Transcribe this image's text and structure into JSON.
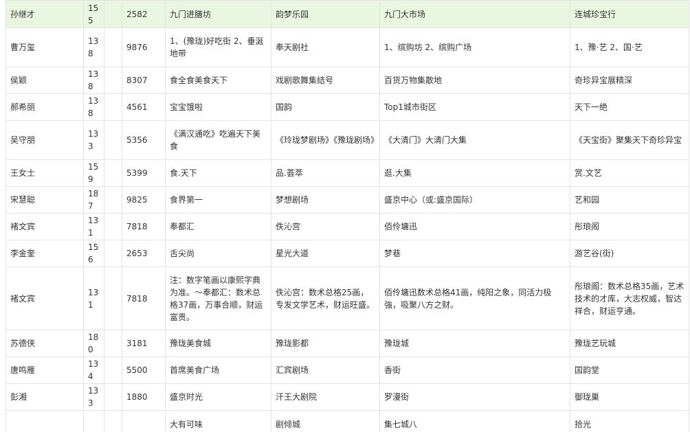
{
  "rows": [
    {
      "name": "孙继才",
      "prefix": "155",
      "suffix": "2582",
      "c1": "九门进膳坊",
      "c2": "韵梦乐园",
      "c3": "九门大市场",
      "c4": "连城珍宝行"
    },
    {
      "name": "曹万玺",
      "prefix": "138",
      "suffix": "9876",
      "c1": "1、(豫珑)好吃街 2、垂涎地带",
      "c2": "奉天剧社",
      "c3": "1、缤购坊 2、缤购广场",
      "c4": "1、豫·艺 2、国·艺"
    },
    {
      "name": "侯颖",
      "prefix": "138",
      "suffix": "8307",
      "c1": "食全食美食天下",
      "c2": "戏剧歌舞集结号",
      "c3": "百货万物集散地",
      "c4": "奇珍异宝展精深"
    },
    {
      "name": "郝希丽",
      "prefix": "138",
      "suffix": "4561",
      "c1": "宝宝饿啦",
      "c2": "国韵",
      "c3": "Top1城市街区",
      "c4": "天下一绝"
    },
    {
      "name": "吴守朋",
      "prefix": "133",
      "suffix": "5356",
      "c1": "《满汉通吃》吃遍天下美食",
      "c2": "《玲珑梦剧场》《豫珑剧场》",
      "c3": "《大清门》大清门大集",
      "c4": "《天宝街》聚集天下奇珍异宝"
    },
    {
      "name": "王女士",
      "prefix": "159",
      "suffix": "5399",
      "c1": "食.天下",
      "c2": "品.荟萃",
      "c3": "逛.大集",
      "c4": "赏.文艺"
    },
    {
      "name": "宋慧聪",
      "prefix": "187",
      "suffix": "9825",
      "c1": "食界第一",
      "c2": "梦想剧场",
      "c3": "盛京中心（或:盛京国际）",
      "c4": "艺和园"
    },
    {
      "name": "褚文宾",
      "prefix": "131",
      "suffix": "7818",
      "c1": "奉都汇",
      "c2": "佚沁宫",
      "c3": "佰伶墉迅",
      "c4": "彤琅阁"
    },
    {
      "name": "李金奎",
      "prefix": "156",
      "suffix": "2653",
      "c1": "舌尖尚",
      "c2": "星光大道",
      "c3": "梦巷",
      "c4": "游艺谷(街)"
    },
    {
      "name": "褚文宾",
      "prefix": "131",
      "suffix": "7818",
      "c1": "注：数字笔画以康熙字典为准。～奉都汇：数术总格37画，万事合顺，财运富贵。",
      "c2": "佚沁宫：数术总格25画，专发文学艺术，财运旺盛。",
      "c3": "佰伶墉迅数术总格41画，纯阳之象，同活力极強，吸聚八方之财。",
      "c4": "彤琅阁：数术总格35画，艺术技术的才库，大志权威，智达祥合，财运亨通。"
    },
    {
      "name": "苏德侠",
      "prefix": "180",
      "suffix": "3181",
      "c1": "豫珑美食城",
      "c2": "豫珑影都",
      "c3": "豫珑城",
      "c4": "豫珑艺玩城"
    },
    {
      "name": "唐鸣雁",
      "prefix": "134",
      "suffix": "5500",
      "c1": "首席美食广场",
      "c2": "汇宾剧场",
      "c3": "香街",
      "c4": "国韵堂"
    },
    {
      "name": "彭湘",
      "prefix": "133",
      "suffix": "1880",
      "c1": "盛京时光",
      "c2": "汗王大剧院",
      "c3": "罗漫街",
      "c4": "御珑巢"
    },
    {
      "name": "",
      "prefix": "",
      "suffix": "",
      "c1": "大有可味",
      "c2": "剧倾城",
      "c3": "集七城八",
      "c4": "拾光"
    }
  ]
}
